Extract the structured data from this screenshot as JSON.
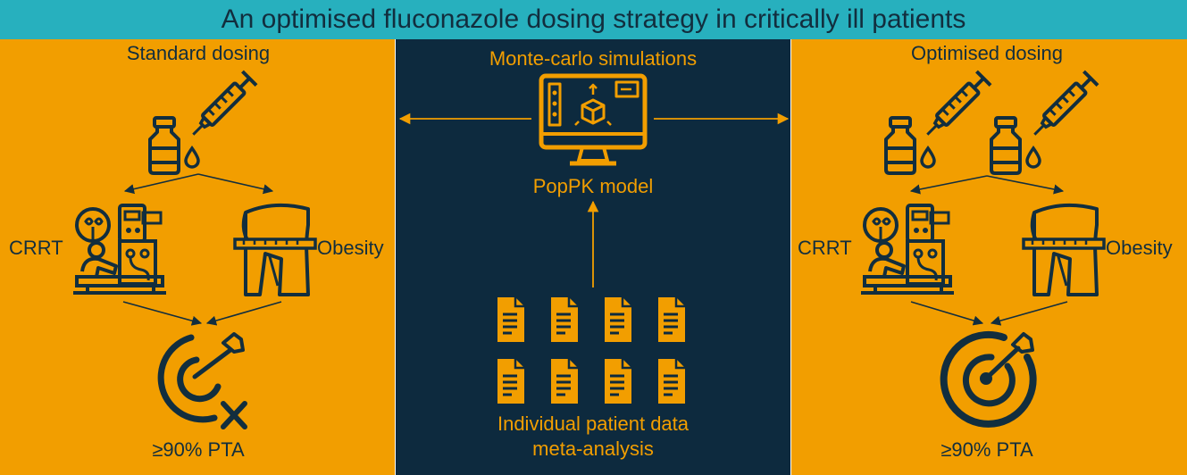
{
  "title": "An optimised fluconazole dosing strategy in critically ill patients",
  "colors": {
    "title_bar": "#27B0BE",
    "side_panel": "#F29E00",
    "center_panel": "#0D2A3E",
    "dark_ink": "#122E3E"
  },
  "left": {
    "heading": "Standard dosing",
    "factor_left": "CRRT",
    "factor_right": "Obesity",
    "outcome": "≥90% PTA",
    "icons": [
      "vial-icon",
      "syringe-icon",
      "crrt-machine-icon",
      "obesity-waist-icon",
      "missed-target-icon"
    ]
  },
  "center": {
    "top_label": "Monte-carlo simulations",
    "model_label": "PopPK model",
    "data_label_line1": "Individual patient data",
    "data_label_line2": "meta-analysis",
    "icons": [
      "computer-monitor-icon",
      "document-icon"
    ]
  },
  "right": {
    "heading": "Optimised dosing",
    "factor_left": "CRRT",
    "factor_right": "Obesity",
    "outcome": "≥90% PTA",
    "icons": [
      "vial-icon",
      "syringe-icon",
      "crrt-machine-icon",
      "obesity-waist-icon",
      "hit-target-icon"
    ]
  }
}
